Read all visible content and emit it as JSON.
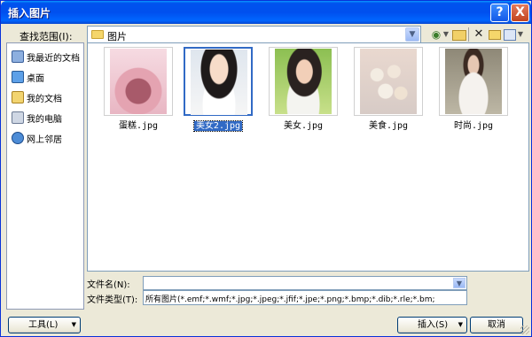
{
  "window": {
    "title": "插入图片"
  },
  "title_buttons": {
    "help": "?",
    "close": "X"
  },
  "look_in": {
    "label": "查找范围(I):",
    "value": "图片"
  },
  "places": [
    {
      "label": "我最近的文档",
      "icon": "recent-documents-icon"
    },
    {
      "label": "桌面",
      "icon": "desktop-icon"
    },
    {
      "label": "我的文档",
      "icon": "my-documents-icon"
    },
    {
      "label": "我的电脑",
      "icon": "my-computer-icon"
    },
    {
      "label": "网上邻居",
      "icon": "network-places-icon"
    }
  ],
  "files": [
    {
      "name": "蛋糕.jpg",
      "selected": false
    },
    {
      "name": "美女2.jpg",
      "selected": true
    },
    {
      "name": "美女.jpg",
      "selected": false
    },
    {
      "name": "美食.jpg",
      "selected": false
    },
    {
      "name": "时尚.jpg",
      "selected": false
    }
  ],
  "file_name": {
    "label": "文件名(N):",
    "value": ""
  },
  "file_type": {
    "label": "文件类型(T):",
    "value": "所有图片(*.emf;*.wmf;*.jpg;*.jpeg;*.jfif;*.jpe;*.png;*.bmp;*.dib;*.rle;*.bm;"
  },
  "buttons": {
    "tools": "工具(L)",
    "insert": "插入(S)",
    "cancel": "取消"
  },
  "colors": {
    "titlebar": "#0053ee",
    "selection": "#316ac5",
    "dialog_bg": "#ece9d8"
  }
}
